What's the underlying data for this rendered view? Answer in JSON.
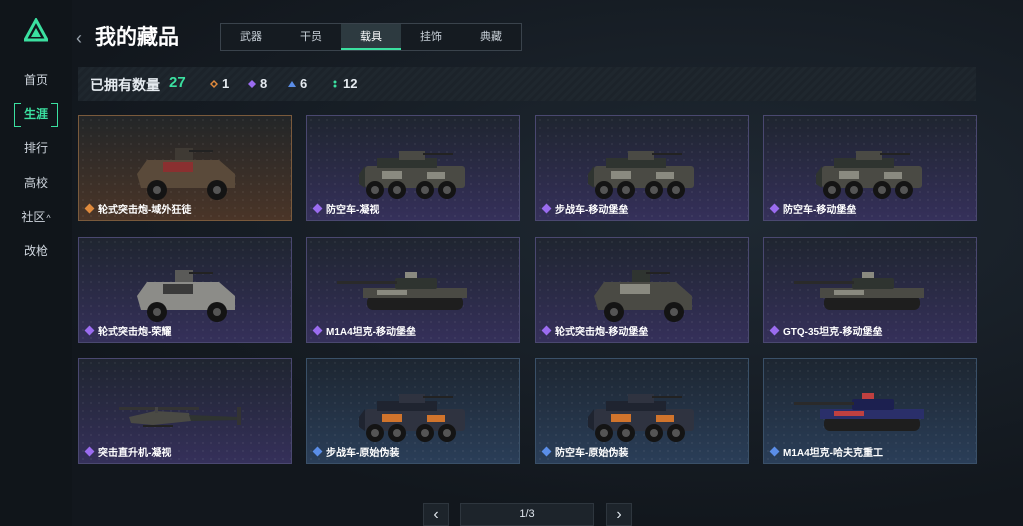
{
  "sidebar": {
    "items": [
      {
        "label": "首页"
      },
      {
        "label": "生涯"
      },
      {
        "label": "排行"
      },
      {
        "label": "高校"
      },
      {
        "label": "社区",
        "caret": "^"
      },
      {
        "label": "改枪"
      }
    ]
  },
  "header": {
    "title": "我的藏品",
    "tabs": [
      "武器",
      "干员",
      "载具",
      "挂饰",
      "典藏"
    ]
  },
  "owned": {
    "label": "已拥有数量",
    "count": "27",
    "rarity_counts": [
      "1",
      "8",
      "6",
      "12"
    ]
  },
  "colors": {
    "accent": "#3be0a0",
    "orange": "#e08a3c",
    "purple": "#9b6cf0",
    "blue": "#5b8ee8",
    "green": "#3be0a0"
  },
  "cards": [
    {
      "name": "轮式突击炮-域外狂徒",
      "rarity": "orange",
      "icon": "armored-car-icon"
    },
    {
      "name": "防空车-凝视",
      "rarity": "purple",
      "icon": "apc-icon"
    },
    {
      "name": "步战车-移动堡垒",
      "rarity": "purple",
      "icon": "apc-icon"
    },
    {
      "name": "防空车-移动堡垒",
      "rarity": "purple",
      "icon": "apc-icon"
    },
    {
      "name": "轮式突击炮-荣耀",
      "rarity": "purple",
      "icon": "armored-car-icon"
    },
    {
      "name": "M1A4坦克-移动堡垒",
      "rarity": "purple",
      "icon": "tank-icon"
    },
    {
      "name": "轮式突击炮-移动堡垒",
      "rarity": "purple",
      "icon": "armored-car-icon"
    },
    {
      "name": "GTQ-35坦克-移动堡垒",
      "rarity": "purple",
      "icon": "tank-icon"
    },
    {
      "name": "突击直升机-凝视",
      "rarity": "purple",
      "icon": "helicopter-icon"
    },
    {
      "name": "步战车-原始伪装",
      "rarity": "blue",
      "icon": "apc-icon"
    },
    {
      "name": "防空车-原始伪装",
      "rarity": "blue",
      "icon": "apc-icon"
    },
    {
      "name": "M1A4坦克-哈夫克重工",
      "rarity": "blue",
      "icon": "tank-icon"
    }
  ],
  "pager": {
    "text": "1/3",
    "prev": "‹",
    "next": "›"
  }
}
